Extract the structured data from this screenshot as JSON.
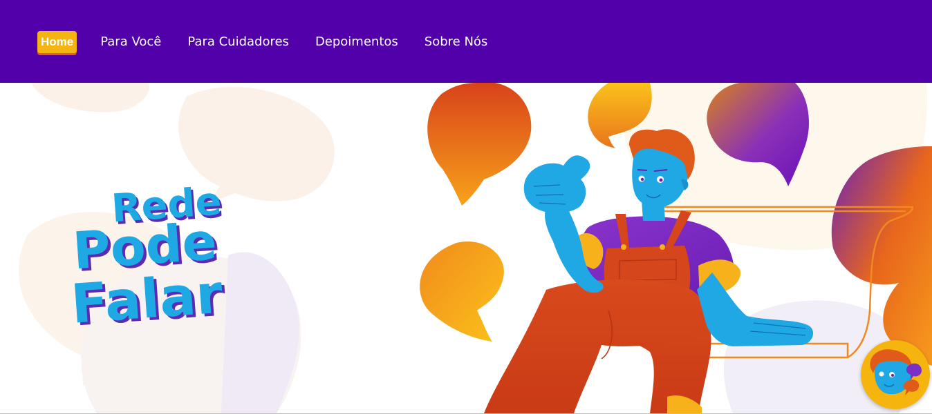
{
  "nav": {
    "items": [
      {
        "label": "Home",
        "active": true
      },
      {
        "label": "Para Você",
        "active": false
      },
      {
        "label": "Para Cuidadores",
        "active": false
      },
      {
        "label": "Depoimentos",
        "active": false
      },
      {
        "label": "Sobre Nós",
        "active": false
      }
    ]
  },
  "hero": {
    "logo_lines": [
      "Rede",
      "Pode",
      "Falar"
    ],
    "illustration": "person-thumbs-up-with-speech-bubbles"
  },
  "chat_widget": {
    "icon": "chat-avatar-icon"
  },
  "colors": {
    "topbar": "#5100aa",
    "nav_active_bg": "#f4b412",
    "nav_active_shadow": "#e85a1c",
    "logo_blue": "#1ea9e4",
    "logo_shadow": "#5b2bb4",
    "skin": "#20a8e4",
    "overalls": "#d6461c",
    "shirt": "#7a2fc6",
    "hair": "#e05a1a",
    "accent_yellow": "#fbb816"
  }
}
